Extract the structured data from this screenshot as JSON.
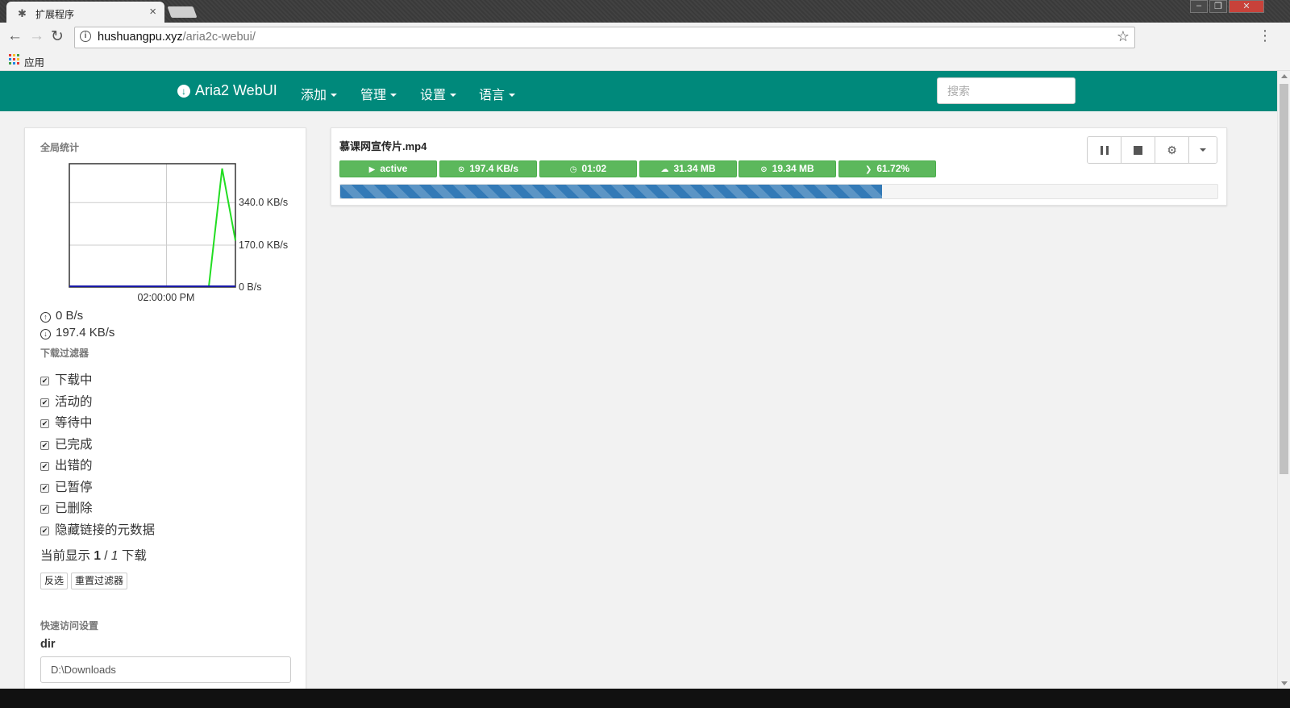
{
  "browser": {
    "tab_title": "扩展程序",
    "tab_icon": "puzzle-icon",
    "url_host": "hushuangpu.xyz",
    "url_path": "/aria2c-webui/",
    "bookmarks": {
      "apps_label": "应用"
    }
  },
  "navbar": {
    "brand": "Aria2 WebUI",
    "menus": [
      "添加",
      "管理",
      "设置",
      "语言"
    ],
    "search_placeholder": "搜索",
    "color": "#00897b"
  },
  "sidebar": {
    "stats_title": "全局统计",
    "upload_speed": "0 B/s",
    "download_speed": "197.4 KB/s",
    "filter_title": "下载过滤器",
    "filters": [
      {
        "label": "下载中",
        "checked": true
      },
      {
        "label": "活动的",
        "checked": true
      },
      {
        "label": "等待中",
        "checked": true
      },
      {
        "label": "已完成",
        "checked": true
      },
      {
        "label": "出错的",
        "checked": true
      },
      {
        "label": "已暂停",
        "checked": true
      },
      {
        "label": "已删除",
        "checked": true
      },
      {
        "label": "隐藏链接的元数据",
        "checked": true
      }
    ],
    "count_prefix": "当前显示",
    "count_shown": "1",
    "count_sep": "/",
    "count_total": "1",
    "count_suffix": "下载",
    "invert_button": "反选",
    "reset_button": "重置过滤器",
    "quick_title": "快速访问设置",
    "dir_label": "dir",
    "dir_value": "D:\\Downloads"
  },
  "chart_data": {
    "type": "line",
    "x_tick_label": "02:00:00 PM",
    "y_tick_labels": [
      "340.0 KB/s",
      "170.0 KB/s",
      "0 B/s"
    ],
    "ylim": [
      0,
      500
    ],
    "grid": true,
    "series": [
      {
        "color": "#22dd22",
        "points": [
          [
            0,
            0
          ],
          [
            0.84,
            0
          ],
          [
            0.92,
            490
          ],
          [
            1.0,
            190
          ]
        ]
      },
      {
        "color": "#1a1aa8",
        "points": [
          [
            0,
            0
          ],
          [
            1.0,
            0
          ]
        ]
      }
    ]
  },
  "download": {
    "name": "慕课网宣传片.mp4",
    "status": "active",
    "speed": "197.4 KB/s",
    "eta": "01:02",
    "size": "31.34 MB",
    "downloaded": "19.34 MB",
    "percent_label": "61.72%",
    "progress": 0.6172,
    "badge_color": "#5cb85c",
    "bar_color": "#337ab7"
  }
}
